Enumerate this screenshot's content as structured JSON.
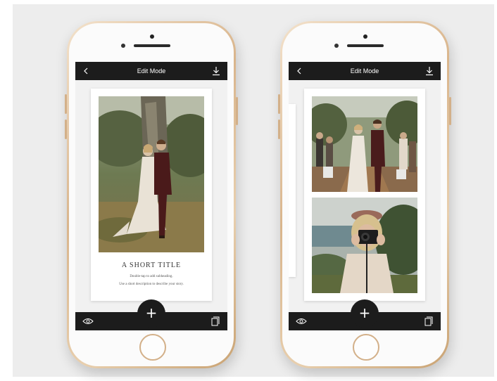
{
  "phones": [
    {
      "header": {
        "title": "Edit Mode",
        "back_icon": "chevron-left-icon",
        "download_icon": "download-icon"
      },
      "story": {
        "title": "A SHORT TITLE",
        "subheading": "Double-tap to add subheading.",
        "description": "Use a short description to describe your story."
      },
      "footer": {
        "preview_icon": "eye-icon",
        "add_label": "+",
        "pages_icon": "pages-icon"
      }
    },
    {
      "header": {
        "title": "Edit Mode",
        "back_icon": "chevron-left-icon",
        "download_icon": "download-icon"
      },
      "footer": {
        "preview_icon": "eye-icon",
        "add_label": "+",
        "pages_icon": "pages-icon"
      }
    }
  ],
  "colors": {
    "bar": "#1c1c1c",
    "phone_gold": "#d9b58c",
    "screen_bg": "#f1f1f1",
    "backdrop": "#ededed"
  }
}
